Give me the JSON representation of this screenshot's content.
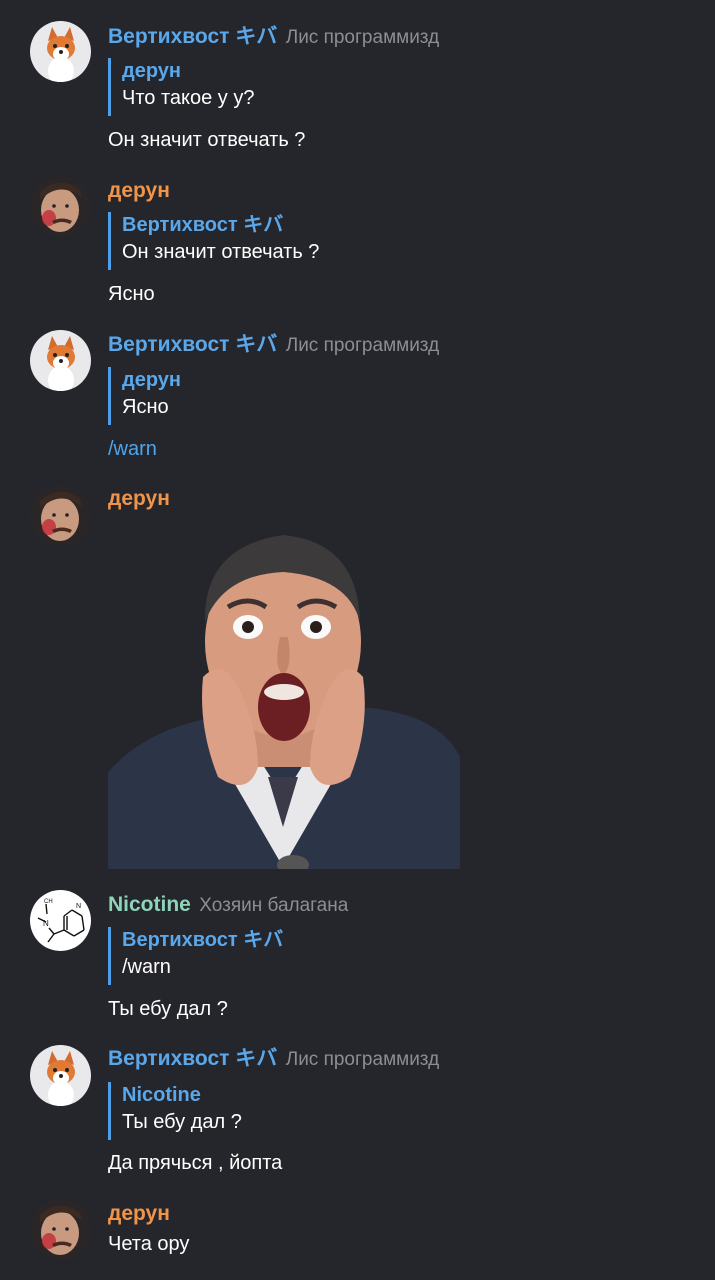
{
  "colors": {
    "background": "#25252c",
    "name_blue": "#5aa7ea",
    "name_orange": "#f0944a",
    "name_green": "#8ed4b8",
    "role_gray": "#8d8d96",
    "reply_bar": "#4c9fe8",
    "command_link": "#4ea6ee"
  },
  "messages": [
    {
      "author": "Вертихвост キバ",
      "role": "Лис программизд",
      "avatar_icon": "fox-avatar-icon",
      "reply_to": "дерун",
      "reply_text": "Что такое у у?",
      "text": "Он значит отвечать ?"
    },
    {
      "author": "дерун",
      "avatar_icon": "man-avatar-icon",
      "reply_to": "Вертихвост キバ",
      "reply_text": "Он значит отвечать ?",
      "text": "Ясно"
    },
    {
      "author": "Вертихвост キバ",
      "role": "Лис программизд",
      "avatar_icon": "fox-avatar-icon",
      "reply_to": "дерун",
      "reply_text": "Ясно",
      "text": "/warn"
    },
    {
      "author": "дерун",
      "avatar_icon": "man-avatar-icon",
      "sticker": "shocked-man-sticker"
    },
    {
      "author": "Nicotine",
      "role": "Хозяин балагана",
      "avatar_icon": "nicotine-molecule-icon",
      "reply_to": "Вертихвост キバ",
      "reply_text": "/warn",
      "text": "Ты ебу дал ?"
    },
    {
      "author": "Вертихвост キバ",
      "role": "Лис программизд",
      "avatar_icon": "fox-avatar-icon",
      "reply_to": "Nicotine",
      "reply_text": "Ты ебу дал ?",
      "text": "Да прячься , йопта"
    },
    {
      "author": "дерун",
      "avatar_icon": "man-avatar-icon",
      "text": "Чета ору"
    }
  ]
}
